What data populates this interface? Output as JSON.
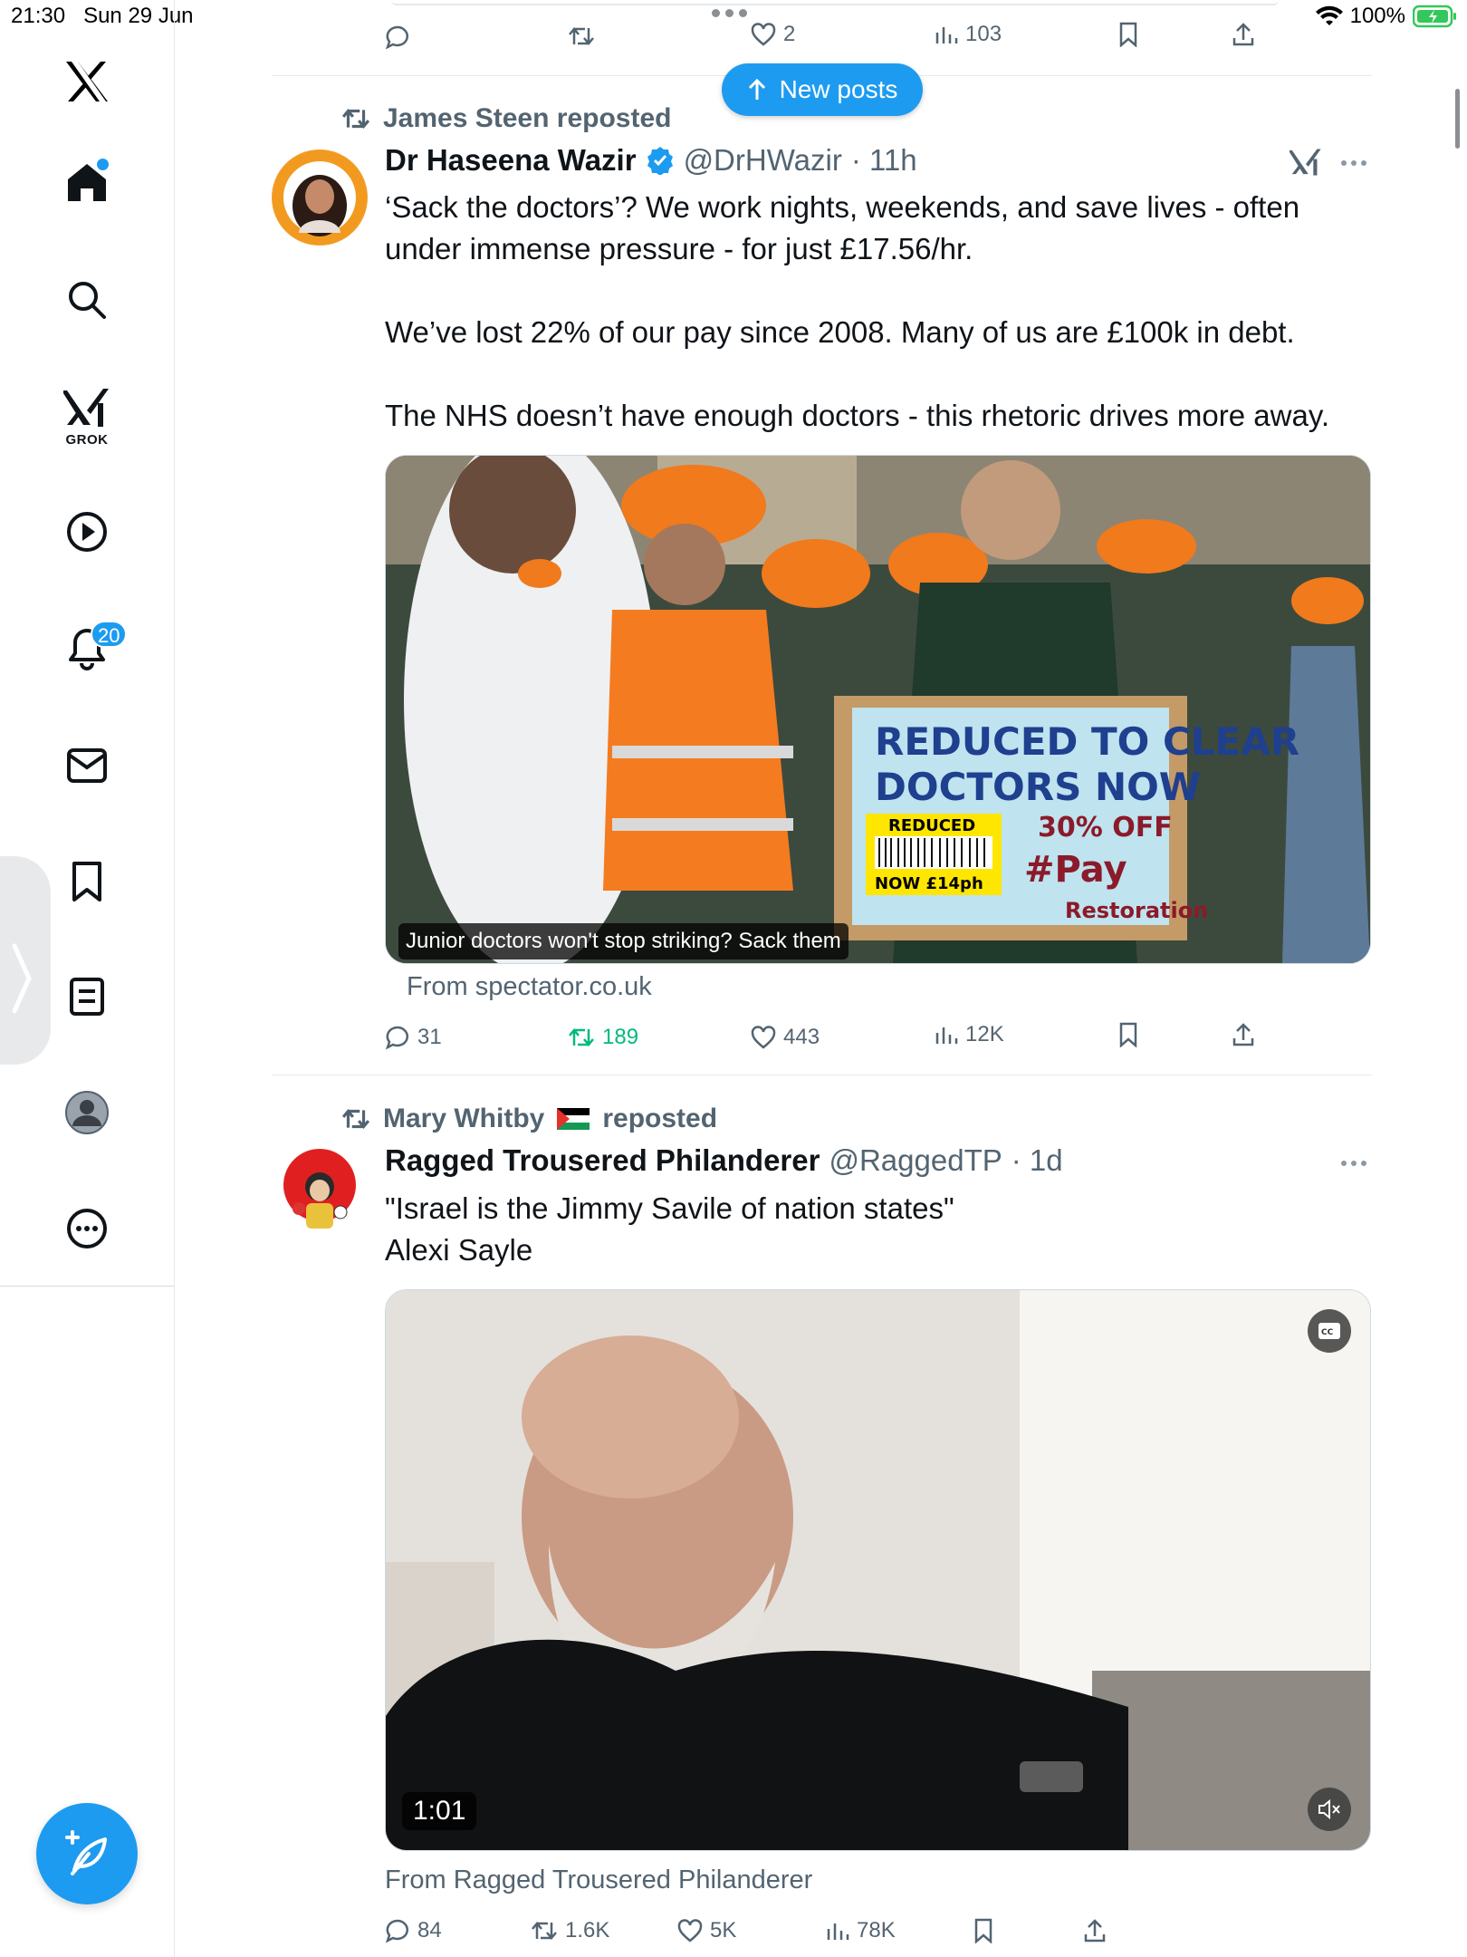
{
  "status_bar": {
    "time": "21:30",
    "date": "Sun 29 Jun",
    "battery": "100%"
  },
  "sidebar": {
    "grok_label": "GROK",
    "notification_count": "20"
  },
  "top_actions": {
    "likes": "2",
    "views": "103"
  },
  "new_posts_label": "New posts",
  "posts": [
    {
      "reposted_by": "James Steen reposted",
      "name": "Dr Haseena Wazir",
      "handle": "@DrHWazir",
      "time": "· 11h",
      "text": "‘Sack the doctors’? We work nights, weekends, and save lives - often under immense pressure - for just £17.56/hr.\n\nWe’ve lost 22% of our pay since 2008. Many of us are £100k in debt.\n\nThe NHS doesn’t have enough doctors - this rhetoric drives more away.",
      "card_caption": "Junior doctors won't stop striking? Sack them",
      "source": "From spectator.co.uk",
      "sign_line1": "REDUCED TO CLEAR",
      "sign_line2": "DOCTORS NOW",
      "sign_tag": "REDUCED",
      "sign_offer": "30% OFF",
      "sign_hashtag": "#Pay",
      "sign_hashtag2": "Restoration",
      "sign_price": "NOW £14ph",
      "replies": "31",
      "reposts": "189",
      "likes": "443",
      "views": "12K"
    },
    {
      "reposted_by": "Mary Whitby",
      "reposted_suffix": "reposted",
      "name": "Ragged Trousered Philanderer",
      "handle": "@RaggedTP",
      "time": "· 1d",
      "text": "\"Israel is the Jimmy Savile of nation states\"\nAlexi Sayle",
      "video_duration": "1:01",
      "source": "From Ragged Trousered Philanderer",
      "replies": "84",
      "reposts": "1.6K",
      "likes": "5K",
      "views": "78K"
    }
  ],
  "colors": {
    "accent": "#1d9bf0",
    "repost_green": "#00ba7c",
    "muted": "#536471"
  }
}
